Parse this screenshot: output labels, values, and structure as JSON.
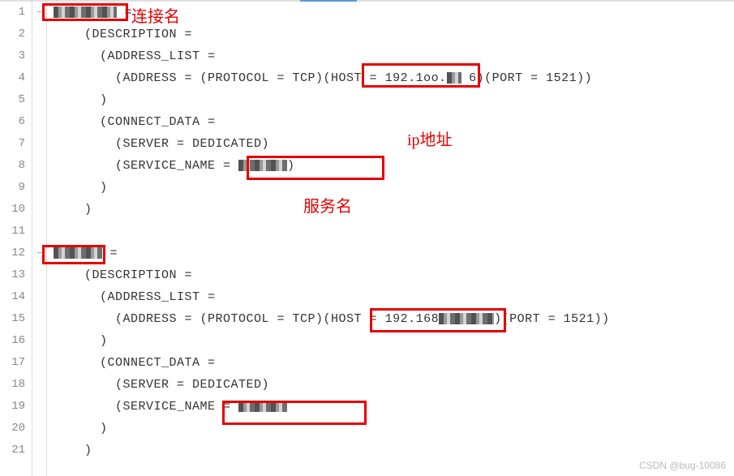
{
  "lineCount": 21,
  "foldMarkers": {
    "1": "−",
    "12": "−"
  },
  "code": {
    "l1": {
      "suffix": " ="
    },
    "l2": "    (DESCRIPTION =",
    "l3": "      (ADDRESS_LIST =",
    "l4": {
      "prefix": "        (ADDRESS = (PROTOCOL = TCP)(HOST = 192.1oo.",
      "mid": " 6)",
      "suffix": "(PORT = 1521))"
    },
    "l5": "      )",
    "l6": "      (CONNECT_DATA =",
    "l7": "        (SERVER = DEDICATED)",
    "l8": {
      "prefix": "        (SERVICE_NAME = ",
      "suffix": ")"
    },
    "l9": "      )",
    "l10": "    )",
    "l11": "",
    "l12": {
      "suffix": " ="
    },
    "l13": "    (DESCRIPTION =",
    "l14": "      (ADDRESS_LIST =",
    "l15": {
      "prefix": "        (ADDRESS = (PROTOCOL = TCP)(HOST = 192.168",
      "suffix": ")(PORT = 1521))"
    },
    "l16": "      )",
    "l17": "      (CONNECT_DATA =",
    "l18": "        (SERVER = DEDICATED)",
    "l19": {
      "prefix": "        (SERVICE_NAME = ",
      "suffix": ""
    },
    "l20": "      )",
    "l21": "    )"
  },
  "annotations": {
    "connName": "连接名",
    "ipAddr": "ip地址",
    "serviceName": "服务名"
  },
  "watermark": "CSDN @bug-10086"
}
